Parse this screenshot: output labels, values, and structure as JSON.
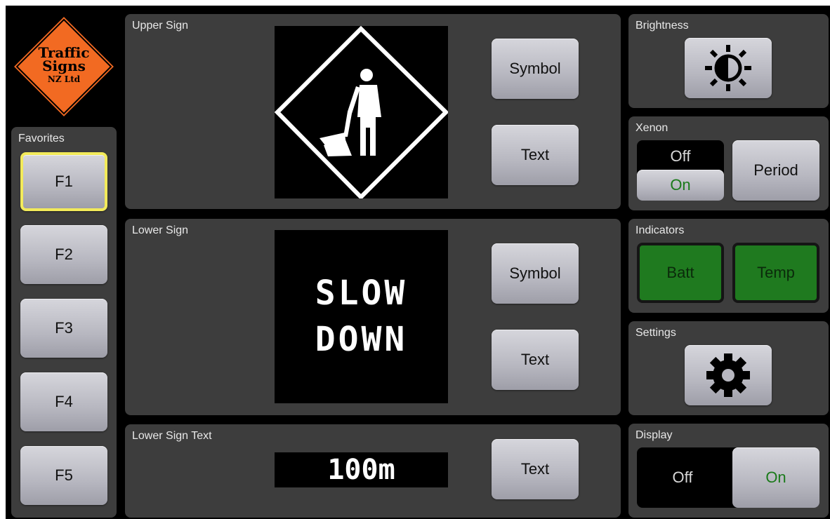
{
  "logo": {
    "line1": "Traffic",
    "line2": "Signs",
    "line3": "NZ Ltd"
  },
  "favorites": {
    "title": "Favorites",
    "buttons": [
      "F1",
      "F2",
      "F3",
      "F4",
      "F5"
    ],
    "selected": "F1"
  },
  "upper_sign": {
    "title": "Upper Sign",
    "symbol_label": "Symbol",
    "text_label": "Text",
    "display_icon": "road-works-icon"
  },
  "lower_sign": {
    "title": "Lower Sign",
    "line1": "SLOW",
    "line2": "DOWN",
    "symbol_label": "Symbol",
    "text_label": "Text"
  },
  "lower_sign_text": {
    "title": "Lower Sign Text",
    "value": "100m",
    "text_label": "Text"
  },
  "brightness": {
    "title": "Brightness",
    "icon": "brightness-icon"
  },
  "xenon": {
    "title": "Xenon",
    "off_label": "Off",
    "on_label": "On",
    "state": "On",
    "period_label": "Period"
  },
  "indicators": {
    "title": "Indicators",
    "batt_label": "Batt",
    "temp_label": "Temp",
    "color": "#1f7a1f"
  },
  "settings": {
    "title": "Settings",
    "icon": "gear-icon"
  },
  "display": {
    "title": "Display",
    "off_label": "Off",
    "on_label": "On",
    "state": "On"
  },
  "colors": {
    "accent_selected": "#f2ea5a",
    "on_text": "#1a7a1a",
    "logo_orange": "#f26a22"
  }
}
